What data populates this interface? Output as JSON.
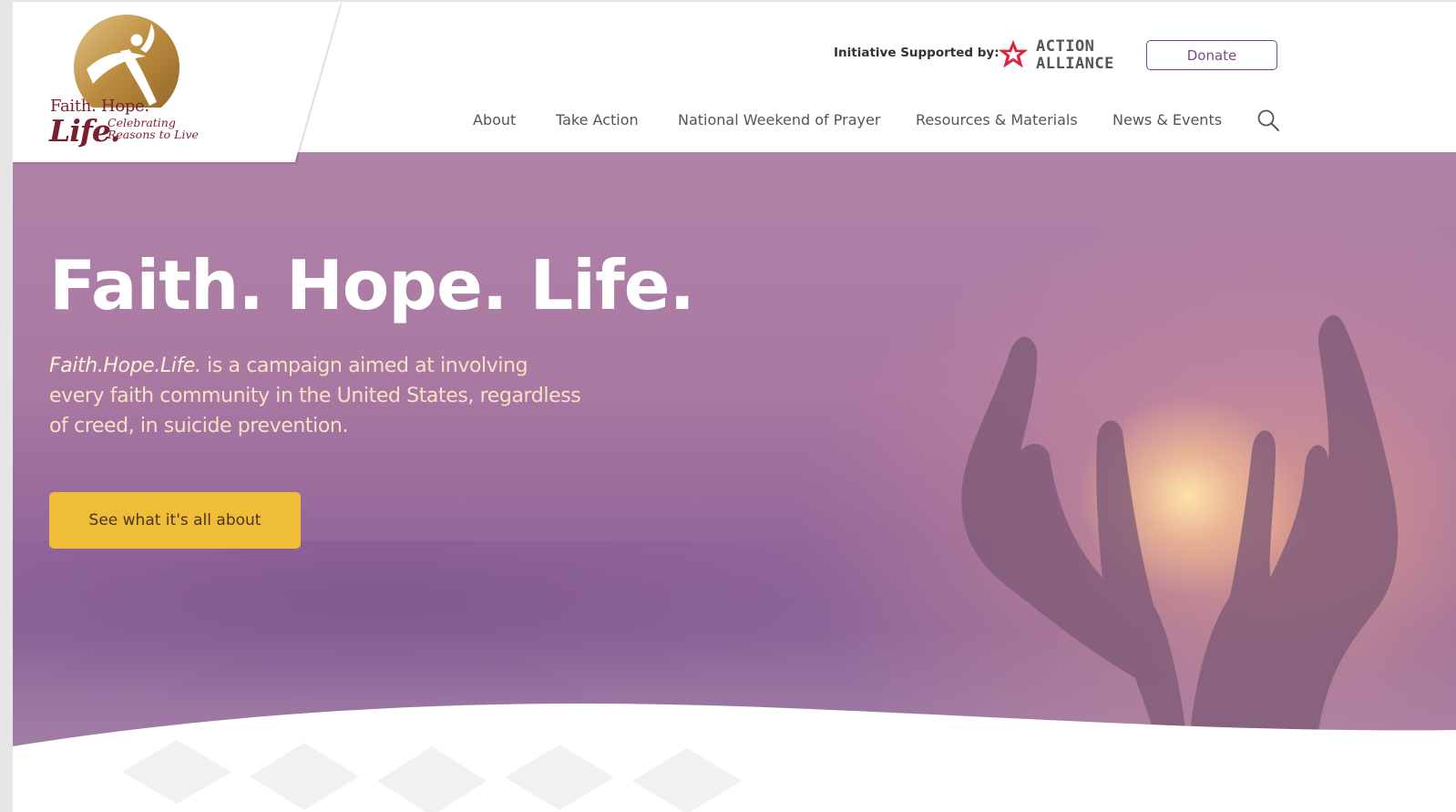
{
  "header": {
    "logo": {
      "line1": "Faith. Hope.",
      "line2": "Life.",
      "tagline1": "Celebrating",
      "tagline2": "Reasons to Live"
    },
    "support_label": "Initiative Supported by:",
    "partner": {
      "line1": "ACTION",
      "line2": "ALLIANCE",
      "icon": "action-alliance-star-icon"
    },
    "donate_label": "Donate",
    "nav": [
      "About",
      "Take Action",
      "National Weekend of Prayer",
      "Resources & Materials",
      "News & Events"
    ],
    "search_icon": "search-icon"
  },
  "hero": {
    "title": "Faith. Hope. Life.",
    "intro_emphasis": "Faith.Hope.Life.",
    "intro_rest": " is a campaign aimed at involving every faith community in the United States, regardless of creed, in suicide prevention.",
    "cta_label": "See what it's all about"
  },
  "colors": {
    "brand_maroon": "#7a1f2e",
    "gold": "#c49a4a",
    "button_yellow": "#f0bd39",
    "donate_purple": "#7b4a8b",
    "hero_purple": "#a978a2",
    "partner_red": "#d7263d"
  }
}
